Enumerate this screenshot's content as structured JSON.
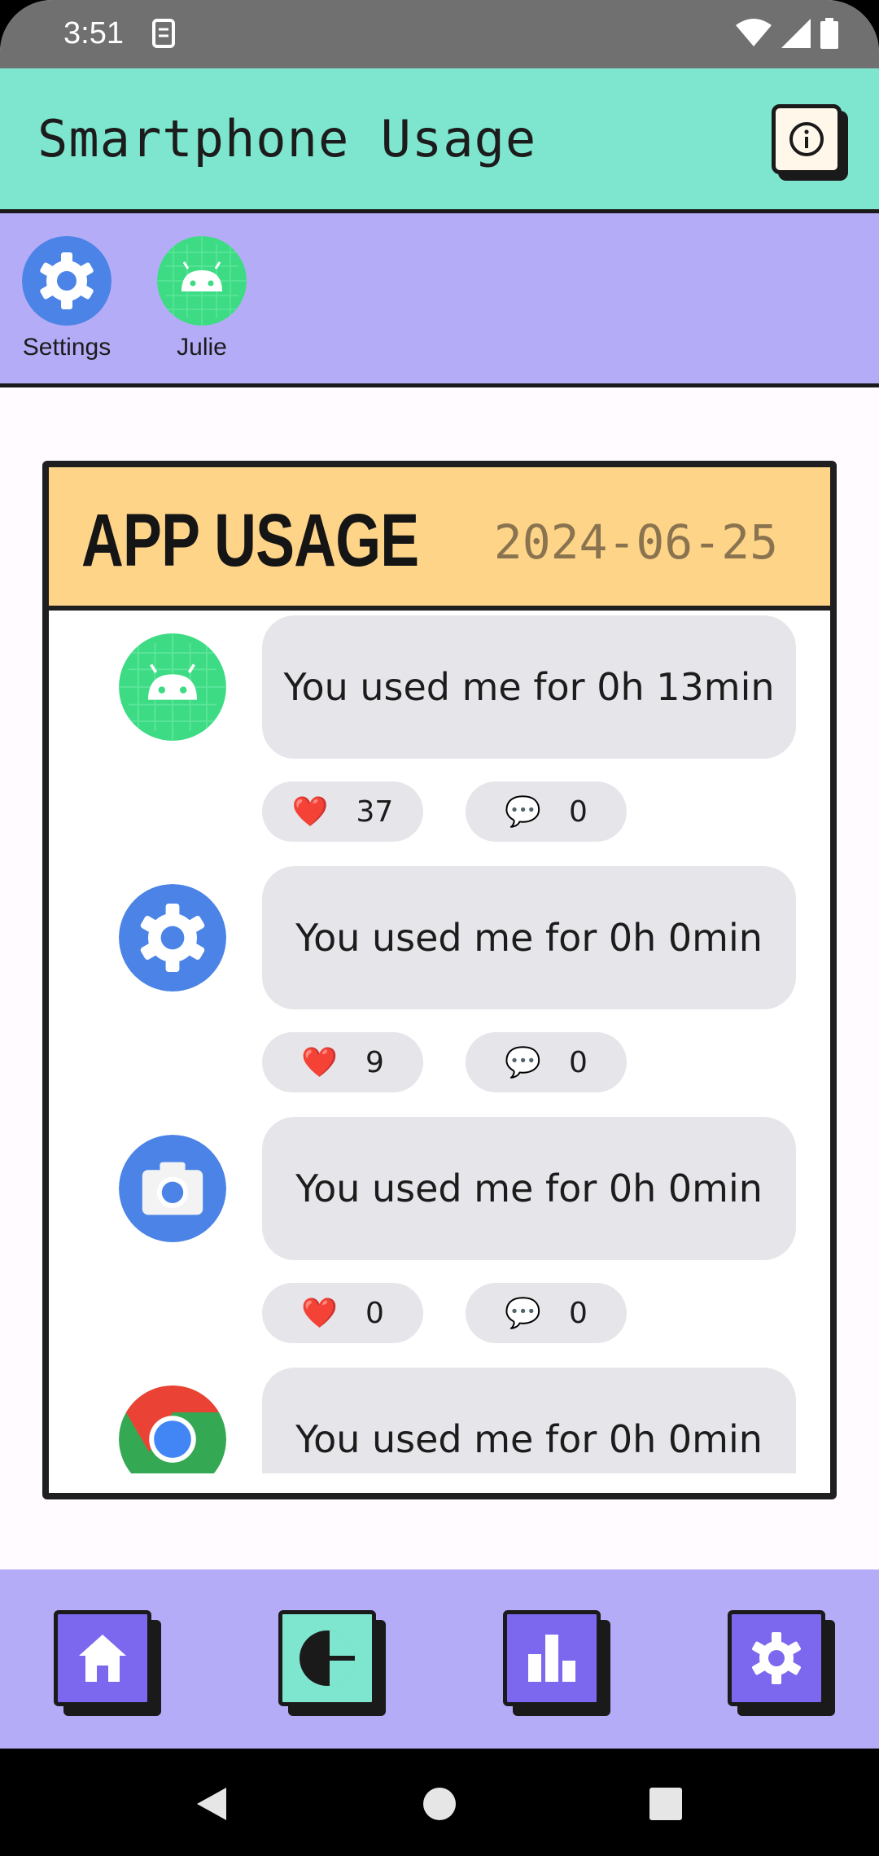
{
  "status_bar": {
    "time": "3:51"
  },
  "app_bar": {
    "title": "Smartphone Usage",
    "info_icon": "info-icon"
  },
  "shortcuts": [
    {
      "label": "Settings",
      "icon": "settings-gear-icon"
    },
    {
      "label": "Julie",
      "icon": "android-icon"
    }
  ],
  "card": {
    "title": "APP USAGE",
    "date": "2024-06-25",
    "entries": [
      {
        "icon": "android-icon",
        "message": "You used me for 0h 13min",
        "likes": "37",
        "comments": "0"
      },
      {
        "icon": "settings-gear-icon",
        "message": "You used me for 0h 0min",
        "likes": "9",
        "comments": "0"
      },
      {
        "icon": "camera-icon",
        "message": "You used me for 0h 0min",
        "likes": "0",
        "comments": "0"
      },
      {
        "icon": "chrome-icon",
        "message": "You used me for 0h 0min"
      }
    ]
  },
  "bottom_nav": [
    "home-icon",
    "pie-chart-icon",
    "bar-chart-icon",
    "settings-icon"
  ],
  "colors": {
    "app_bar": "#7ee6cf",
    "strip": "#b4acf6",
    "card_header": "#fed488",
    "nav_purple": "#7c68ee"
  }
}
